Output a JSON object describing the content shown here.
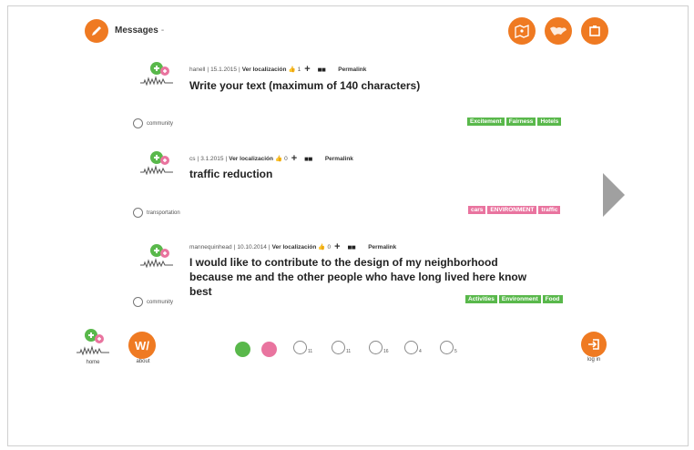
{
  "header": {
    "title": "Messages",
    "caret": "-",
    "icons": [
      "edit-icon",
      "map-icon",
      "world-map-icon",
      "info-icon"
    ]
  },
  "messages": [
    {
      "meta_user": "hanell",
      "meta_date": "15.1.2015",
      "meta_location": "Ver localización",
      "likes": "1",
      "permalink": "Permalink",
      "text": "Write your text (maximum of 140 characters)",
      "category": "community",
      "tags": [
        "Excitement",
        "Fairness",
        "Hotels"
      ],
      "tag_color": "green"
    },
    {
      "meta_user": "cs",
      "meta_date": "3.1.2015",
      "meta_location": "Ver localización",
      "likes": "0",
      "permalink": "Permalink",
      "text": "traffic reduction",
      "category": "transportation",
      "tags": [
        "cars",
        "ENVIRONMENT",
        "traffic"
      ],
      "tag_color": "pink"
    },
    {
      "meta_user": "mannequinhead",
      "meta_date": "10.10.2014",
      "meta_location": "Ver localización",
      "likes": "0",
      "permalink": "Permalink",
      "text_lines": [
        "I would like to contribute to the design of my neighborhood",
        "because me and the other people who have long lived here know",
        "best"
      ],
      "category": "community",
      "tags": [
        "Activities",
        "Environment",
        "Food"
      ],
      "tag_color": "green"
    }
  ],
  "footer": {
    "home_label": "home",
    "about_label": "about",
    "about_logo": "W/",
    "login_label": "log in",
    "stats": [
      {
        "icon": "buildings-icon",
        "count": "11"
      },
      {
        "icon": "community-icon",
        "count": "11"
      },
      {
        "icon": "transport-icon",
        "count": "16"
      },
      {
        "icon": "question-icon",
        "count": "4"
      },
      {
        "icon": "globe-icon",
        "count": "5"
      }
    ]
  },
  "colors": {
    "accent": "#ef7a22",
    "green": "#59b84b",
    "pink": "#e9749f"
  }
}
